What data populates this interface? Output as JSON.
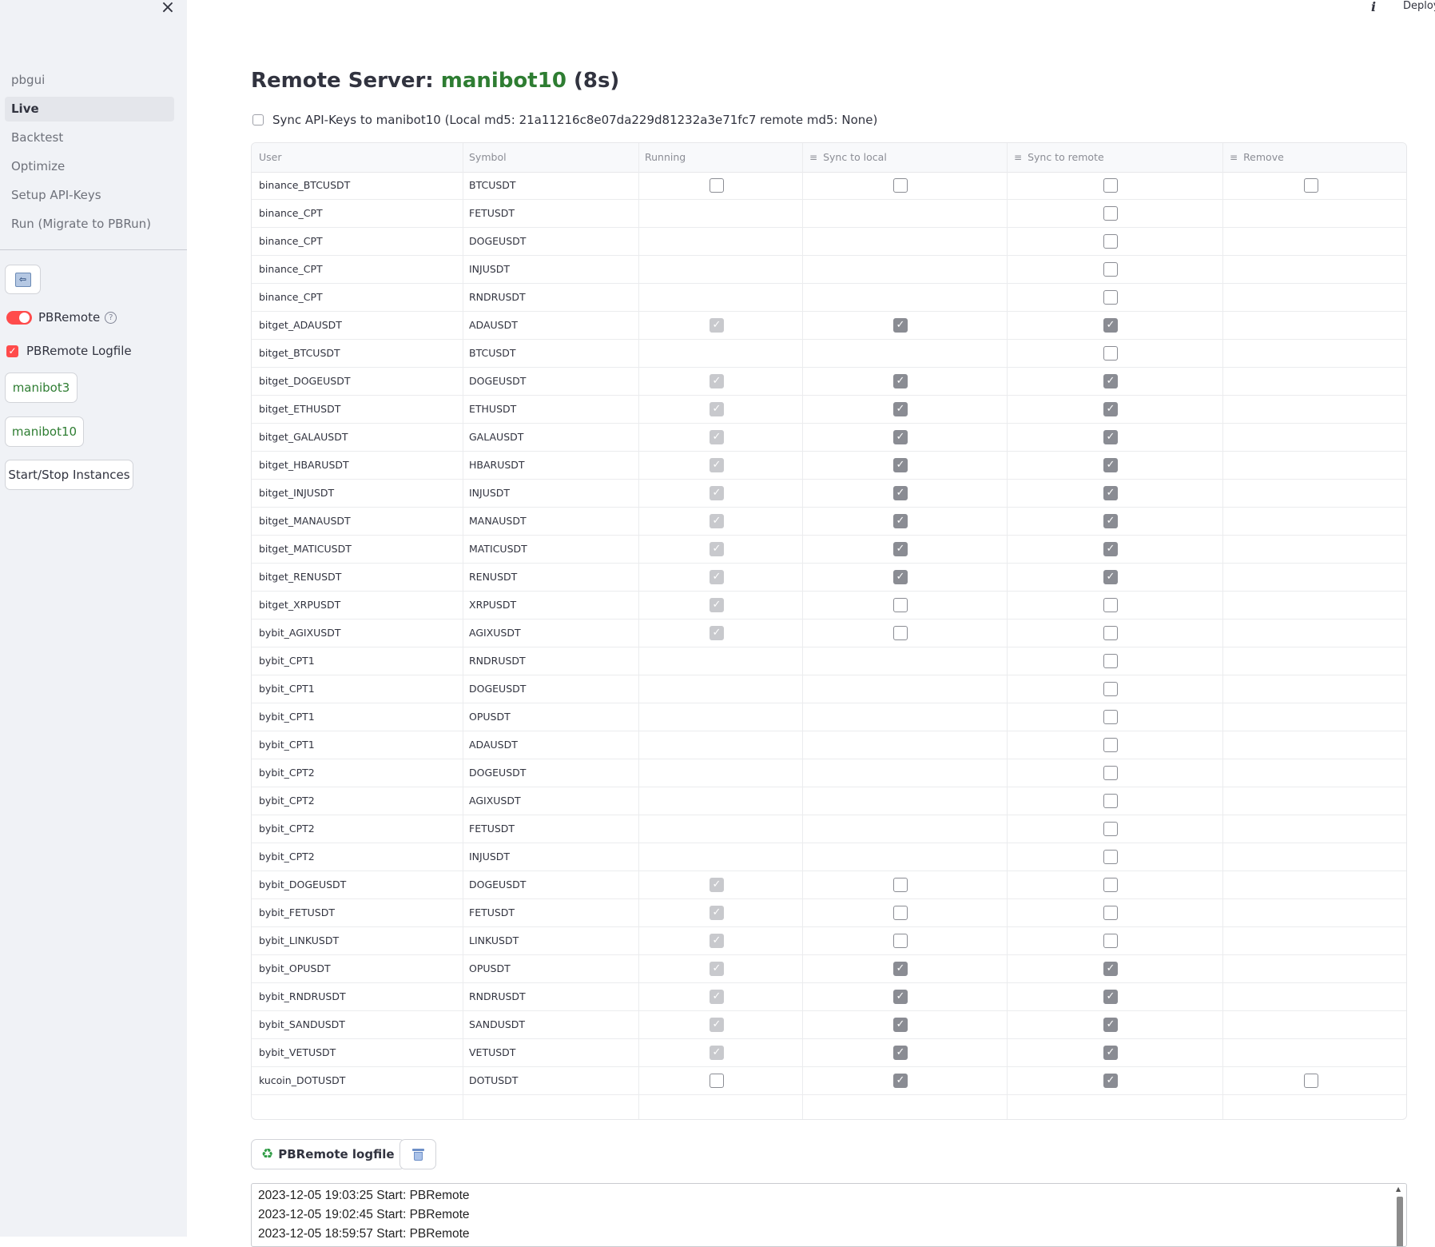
{
  "sidebar": {
    "close_label": "×",
    "nav": [
      {
        "label": "pbgui",
        "active": false
      },
      {
        "label": "Live",
        "active": true
      },
      {
        "label": "Backtest",
        "active": false
      },
      {
        "label": "Optimize",
        "active": false
      },
      {
        "label": "Setup API-Keys",
        "active": false
      },
      {
        "label": "Run (Migrate to PBRun)",
        "active": false
      }
    ],
    "back_icon": "back-arrow-icon",
    "toggle_label": "PBRemote",
    "toggle_on": true,
    "help_glyph": "?",
    "logfile_label": "PBRemote Logfile",
    "logfile_checked": true,
    "servers": [
      "manibot3",
      "manibot10"
    ],
    "start_stop_label": "Start/Stop Instances"
  },
  "topbar": {
    "info_glyph": "i",
    "deploy_label": "Deploy"
  },
  "main": {
    "title_prefix": "Remote Server: ",
    "title_server": "manibot10",
    "title_suffix": " (8s)",
    "sync_label": "Sync API-Keys to manibot10 (Local md5: 21a11216c8e07da229d81232a3e71fc7 remote md5: None)"
  },
  "table": {
    "columns": [
      "User",
      "Symbol",
      "Running",
      "Sync to local",
      "Sync to remote",
      "Remove"
    ],
    "rows": [
      {
        "user": "binance_BTCUSDT",
        "symbol": "BTCUSDT",
        "running": "empty",
        "local": "empty",
        "remote": "empty",
        "remove": "empty"
      },
      {
        "user": "binance_CPT",
        "symbol": "FETUSDT",
        "running": null,
        "local": null,
        "remote": "empty",
        "remove": null
      },
      {
        "user": "binance_CPT",
        "symbol": "DOGEUSDT",
        "running": null,
        "local": null,
        "remote": "empty",
        "remove": null
      },
      {
        "user": "binance_CPT",
        "symbol": "INJUSDT",
        "running": null,
        "local": null,
        "remote": "empty",
        "remove": null
      },
      {
        "user": "binance_CPT",
        "symbol": "RNDRUSDT",
        "running": null,
        "local": null,
        "remote": "empty",
        "remove": null
      },
      {
        "user": "bitget_ADAUSDT",
        "symbol": "ADAUSDT",
        "running": "dim",
        "local": "on",
        "remote": "on",
        "remove": null
      },
      {
        "user": "bitget_BTCUSDT",
        "symbol": "BTCUSDT",
        "running": null,
        "local": null,
        "remote": "empty",
        "remove": null
      },
      {
        "user": "bitget_DOGEUSDT",
        "symbol": "DOGEUSDT",
        "running": "dim",
        "local": "on",
        "remote": "on",
        "remove": null
      },
      {
        "user": "bitget_ETHUSDT",
        "symbol": "ETHUSDT",
        "running": "dim",
        "local": "on",
        "remote": "on",
        "remove": null
      },
      {
        "user": "bitget_GALAUSDT",
        "symbol": "GALAUSDT",
        "running": "dim",
        "local": "on",
        "remote": "on",
        "remove": null
      },
      {
        "user": "bitget_HBARUSDT",
        "symbol": "HBARUSDT",
        "running": "dim",
        "local": "on",
        "remote": "on",
        "remove": null
      },
      {
        "user": "bitget_INJUSDT",
        "symbol": "INJUSDT",
        "running": "dim",
        "local": "on",
        "remote": "on",
        "remove": null
      },
      {
        "user": "bitget_MANAUSDT",
        "symbol": "MANAUSDT",
        "running": "dim",
        "local": "on",
        "remote": "on",
        "remove": null
      },
      {
        "user": "bitget_MATICUSDT",
        "symbol": "MATICUSDT",
        "running": "dim",
        "local": "on",
        "remote": "on",
        "remove": null
      },
      {
        "user": "bitget_RENUSDT",
        "symbol": "RENUSDT",
        "running": "dim",
        "local": "on",
        "remote": "on",
        "remove": null
      },
      {
        "user": "bitget_XRPUSDT",
        "symbol": "XRPUSDT",
        "running": "dim",
        "local": "empty",
        "remote": "empty",
        "remove": null
      },
      {
        "user": "bybit_AGIXUSDT",
        "symbol": "AGIXUSDT",
        "running": "dim",
        "local": "empty",
        "remote": "empty",
        "remove": null
      },
      {
        "user": "bybit_CPT1",
        "symbol": "RNDRUSDT",
        "running": null,
        "local": null,
        "remote": "empty",
        "remove": null
      },
      {
        "user": "bybit_CPT1",
        "symbol": "DOGEUSDT",
        "running": null,
        "local": null,
        "remote": "empty",
        "remove": null
      },
      {
        "user": "bybit_CPT1",
        "symbol": "OPUSDT",
        "running": null,
        "local": null,
        "remote": "empty",
        "remove": null
      },
      {
        "user": "bybit_CPT1",
        "symbol": "ADAUSDT",
        "running": null,
        "local": null,
        "remote": "empty",
        "remove": null
      },
      {
        "user": "bybit_CPT2",
        "symbol": "DOGEUSDT",
        "running": null,
        "local": null,
        "remote": "empty",
        "remove": null
      },
      {
        "user": "bybit_CPT2",
        "symbol": "AGIXUSDT",
        "running": null,
        "local": null,
        "remote": "empty",
        "remove": null
      },
      {
        "user": "bybit_CPT2",
        "symbol": "FETUSDT",
        "running": null,
        "local": null,
        "remote": "empty",
        "remove": null
      },
      {
        "user": "bybit_CPT2",
        "symbol": "INJUSDT",
        "running": null,
        "local": null,
        "remote": "empty",
        "remove": null
      },
      {
        "user": "bybit_DOGEUSDT",
        "symbol": "DOGEUSDT",
        "running": "dim",
        "local": "empty",
        "remote": "empty",
        "remove": null
      },
      {
        "user": "bybit_FETUSDT",
        "symbol": "FETUSDT",
        "running": "dim",
        "local": "empty",
        "remote": "empty",
        "remove": null
      },
      {
        "user": "bybit_LINKUSDT",
        "symbol": "LINKUSDT",
        "running": "dim",
        "local": "empty",
        "remote": "empty",
        "remove": null
      },
      {
        "user": "bybit_OPUSDT",
        "symbol": "OPUSDT",
        "running": "dim",
        "local": "on",
        "remote": "on",
        "remove": null
      },
      {
        "user": "bybit_RNDRUSDT",
        "symbol": "RNDRUSDT",
        "running": "dim",
        "local": "on",
        "remote": "on",
        "remove": null
      },
      {
        "user": "bybit_SANDUSDT",
        "symbol": "SANDUSDT",
        "running": "dim",
        "local": "on",
        "remote": "on",
        "remove": null
      },
      {
        "user": "bybit_VETUSDT",
        "symbol": "VETUSDT",
        "running": "dim",
        "local": "on",
        "remote": "on",
        "remove": null
      },
      {
        "user": "kucoin_DOTUSDT",
        "symbol": "DOTUSDT",
        "running": "empty",
        "local": "on",
        "remote": "on",
        "remove": "empty"
      }
    ]
  },
  "log": {
    "button_label": "PBRemote logfile",
    "recycle_glyph": "♻",
    "trash_icon": "trash-icon",
    "lines": [
      "2023-12-05 19:03:25 Start: PBRemote",
      "2023-12-05 19:02:45 Start: PBRemote",
      "2023-12-05 18:59:57 Start: PBRemote"
    ]
  },
  "colors": {
    "accent_red": "#ff4b4b",
    "server_green": "#2e7d32",
    "sidebar_bg": "#f0f2f6"
  }
}
